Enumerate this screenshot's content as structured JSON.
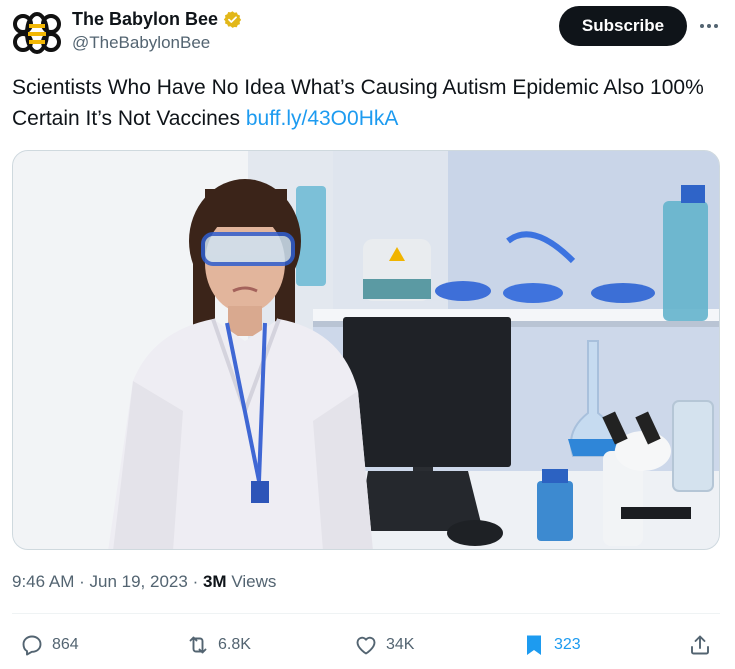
{
  "account": {
    "display_name": "The Babylon Bee",
    "handle": "@TheBabylonBee"
  },
  "header": {
    "subscribe_label": "Subscribe"
  },
  "tweet": {
    "text": "Scientists Who Have No Idea What’s Causing Autism Epidemic Also 100% Certain It’s Not Vaccines",
    "link": "buff.ly/43O0HkA"
  },
  "meta": {
    "time": "9:46 AM",
    "date": "Jun 19, 2023",
    "separator": "·",
    "views_count": "3M",
    "views_label": "Views"
  },
  "actions": {
    "replies": "864",
    "reposts": "6.8K",
    "likes": "34K",
    "bookmarks": "323"
  },
  "icons": {
    "avatar": "bee-logo-icon",
    "verified": "gold-verified-badge-icon",
    "more": "more-horizontal-icon",
    "reply": "reply-icon",
    "repost": "repost-icon",
    "like": "heart-icon",
    "bookmark": "bookmark-icon",
    "share": "share-icon"
  },
  "colors": {
    "link": "#1d9bf0",
    "verified_gold": "#e2b719",
    "bookmark_active": "#1d9bf0",
    "subscribe_bg": "#0f1419"
  }
}
